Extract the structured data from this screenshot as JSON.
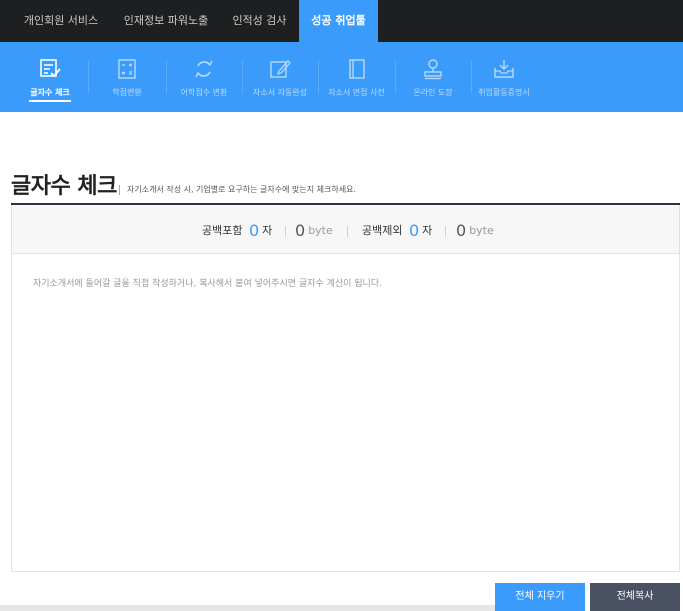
{
  "top_nav": {
    "tabs": [
      {
        "label": "개인회원 서비스",
        "active": false
      },
      {
        "label": "인재정보 파워노출",
        "active": false
      },
      {
        "label": "인적성 검사",
        "active": false
      },
      {
        "label": "성공 취업툴",
        "active": true
      }
    ]
  },
  "sub_nav": {
    "items": [
      {
        "label": "글자수 체크",
        "icon": "edit-check-icon",
        "active": true
      },
      {
        "label": "학점변환",
        "icon": "calculator-icon",
        "active": false
      },
      {
        "label": "어학점수 변환",
        "icon": "refresh-icon",
        "active": false
      },
      {
        "label": "자소서 자동완성",
        "icon": "pencil-square-icon",
        "active": false
      },
      {
        "label": "자소서 면접 사전",
        "icon": "book-icon",
        "active": false
      },
      {
        "label": "온라인 도장",
        "icon": "stamp-icon",
        "active": false
      },
      {
        "label": "취업활동증명서",
        "icon": "inbox-download-icon",
        "active": false
      }
    ]
  },
  "page": {
    "title": "글자수 체크",
    "description": "자기소개서 작성 시, 기업별로 요구하는 글자수에 맞는지 체크하세요."
  },
  "counter": {
    "with_space_label": "공백포함",
    "with_space_chars": "0",
    "char_unit": "자",
    "with_space_bytes": "0",
    "byte_unit": "byte",
    "without_space_label": "공백제외",
    "without_space_chars": "0",
    "without_space_bytes": "0"
  },
  "editor": {
    "placeholder": "자기소개서에 들어갈 글을 직접 작성하거나, 복사해서 붙여 넣어주시면 글자수 계산이 됩니다.",
    "value": ""
  },
  "buttons": {
    "clear_all": "전체 지우기",
    "copy_all": "전체복사"
  },
  "colors": {
    "accent": "#3b9bfb",
    "top_nav_bg": "#1e1f21",
    "copy_button": "#4a5163"
  }
}
